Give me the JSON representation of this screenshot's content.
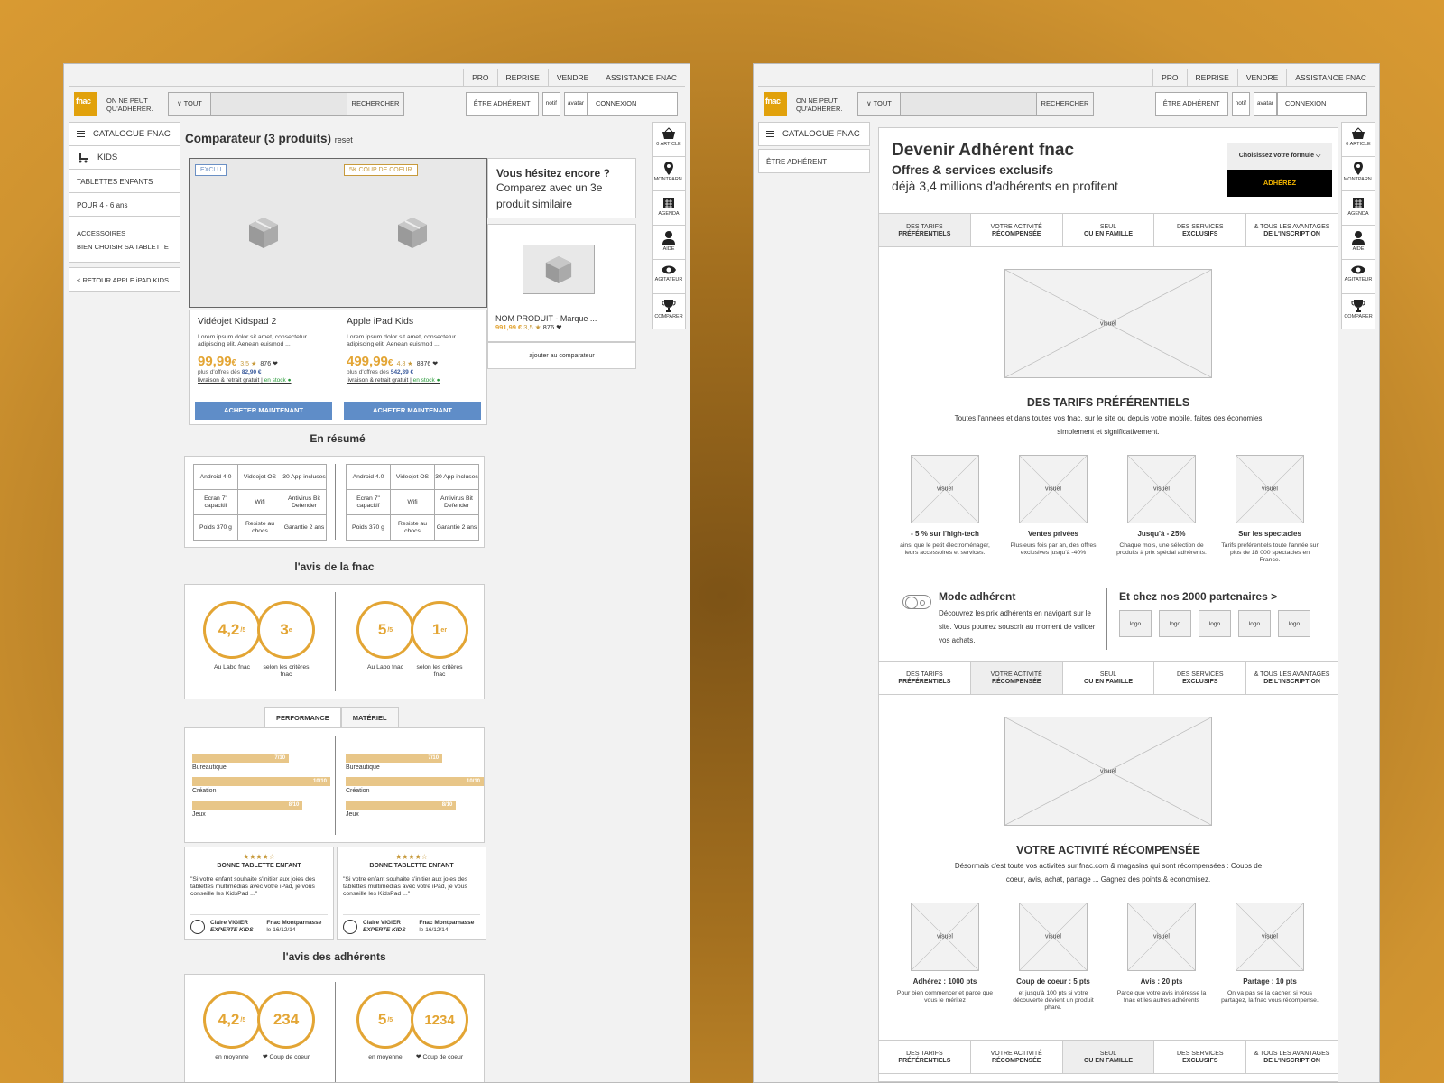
{
  "header": {
    "top_links": [
      "PRO",
      "REPRISE",
      "VENDRE",
      "ASSISTANCE FNAC"
    ],
    "logo": "fnac",
    "slogan": "ON NE PEUT QU'ADHERER.",
    "search_select": "∨ TOUT",
    "search_placeholder": "",
    "search_button": "RECHERCHER",
    "member_button": "ÊTRE ADHÉRENT",
    "notif": "notif",
    "avatar": "avatar",
    "login": "CONNEXION"
  },
  "right_nav": [
    "0 ARTICLE",
    "MONTPARN.",
    "AGENDA",
    "AIDE",
    "AGITATEUR",
    "COMPARER"
  ],
  "left_nav": {
    "catalog": "CATALOGUE FNAC",
    "kids": "KIDS",
    "tablettes": "TABLETTES ENFANTS",
    "age": "POUR 4 - 6 ans",
    "accessoires": "ACCESSOIRES",
    "bien_choisir": "BIEN CHOISIR SA TABLETTE",
    "retour": "< RETOUR APPLE iPAD KIDS"
  },
  "comparator": {
    "title": "Comparateur (3 produits)",
    "reset": "reset",
    "products": [
      {
        "tag": "EXCLU",
        "name": "Vidéojet Kidspad 2",
        "desc": "Lorem ipsum dolor sit amet, consectetur adipiscing elit. Aenean euismod ...",
        "price": "99,99",
        "currency": "€",
        "rating": "3,5 ★",
        "count": "876 ❤",
        "offers_label": "plus d'offres dès",
        "offers_price": "82,90 €",
        "delivery": "livraison & retrait gratuit",
        "stock": "en stock ●",
        "buy": "ACHETER MAINTENANT"
      },
      {
        "tag": "5K COUP DE COEUR",
        "name": "Apple iPad Kids",
        "desc": "Lorem ipsum dolor sit amet, consectetur adipiscing elit. Aenean euismod ...",
        "price": "499,99",
        "currency": "€",
        "rating": "4,8 ★",
        "count": "8376 ❤",
        "offers_label": "plus d'offres dès",
        "offers_price": "542,39 €",
        "delivery": "livraison & retrait gratuit",
        "stock": "en stock ●",
        "buy": "ACHETER MAINTENANT"
      }
    ],
    "hesitez_title": "Vous hésitez encore ?",
    "hesitez_text": "Comparez avec un 3e produit similaire",
    "similar_name": "NOM PRODUIT - Marque ...",
    "similar_price": "991,99 €",
    "similar_rating": "3,5 ★",
    "similar_count": "876 ❤",
    "add_compare": "ajouter au comparateur"
  },
  "resume": {
    "title": "En résumé",
    "specs": [
      "Android 4.0",
      "Videojet OS",
      "30 App incluses",
      "Ecran 7\" capacitif",
      "Wifi",
      "Antivirus Bit Defender",
      "Poids 370 g",
      "Resiste au chocs",
      "Garantie 2 ans"
    ]
  },
  "avis_fnac": {
    "title": "l'avis de la fnac",
    "products": [
      {
        "score": "4,2",
        "scale": "/5",
        "rank": "3",
        "rank_sup": "e",
        "label1": "Au Labo fnac",
        "label2": "selon les critères fnac"
      },
      {
        "score": "5",
        "scale": "/5",
        "rank": "1",
        "rank_sup": "er",
        "label1": "Au Labo fnac",
        "label2": "selon les critères fnac"
      }
    ]
  },
  "perf_tabs": [
    "PERFORMANCE",
    "MATÉRIEL"
  ],
  "perf_bars": [
    {
      "name": "Bureautique",
      "label": "7/10",
      "value": 7
    },
    {
      "name": "Création",
      "label": "10/10",
      "value": 10
    },
    {
      "name": "Jeux",
      "label": "8/10",
      "value": 8
    }
  ],
  "reviews": [
    {
      "stars": "★★★★☆",
      "title": "BONNE TABLETTE ENFANT",
      "text": "\"Si votre enfant souhaite s'initier aux joies des tablettes multimédias avec votre iPad, je vous conseille les KidsPad ...\"",
      "author": "Claire VIGIER",
      "role": "EXPERTE KIDS",
      "shop": "Fnac Montparnasse",
      "date": "le 16/12/14"
    },
    {
      "stars": "★★★★☆",
      "title": "BONNE TABLETTE ENFANT",
      "text": "\"Si votre enfant souhaite s'initier aux joies des tablettes multimédias avec votre iPad, je vous conseille les KidsPad ...\"",
      "author": "Claire VIGIER",
      "role": "EXPERTE KIDS",
      "shop": "Fnac Montparnasse",
      "date": "le 16/12/14"
    }
  ],
  "avis_adherents": {
    "title": "l'avis des adhérents",
    "products": [
      {
        "score": "4,2",
        "scale": "/5",
        "count": "234",
        "label1": "en moyenne",
        "label2": "❤ Coup de coeur"
      },
      {
        "score": "5",
        "scale": "/5",
        "count": "1234",
        "label1": "en moyenne",
        "label2": "❤ Coup de coeur"
      }
    ]
  },
  "adherent": {
    "left_item": "ÊTRE ADHÉRENT",
    "h1": "Devenir Adhérent fnac",
    "h2": "Offres & services exclusifs",
    "h3": "déjà 3,4 millions d'adhérents en profitent",
    "formule": "Choisissez votre formule ⌵",
    "adhere": "ADHÉREZ",
    "tabs": [
      [
        "DES TARIFS",
        "PRÉFÉRENTIELS"
      ],
      [
        "VOTRE ACTIVITÉ",
        "RÉCOMPENSÉE"
      ],
      [
        "SEUL",
        "OU EN FAMILLE"
      ],
      [
        "DES SERVICES",
        "EXCLUSIFS"
      ],
      [
        "& TOUS LES AVANTAGES",
        "DE L'INSCRIPTION"
      ]
    ],
    "visual": "visuel",
    "s1_title": "DES TARIFS PRÉFÉRENTIELS",
    "s1_text": "Toutes l'années et dans toutes vos fnac, sur le site ou depuis votre mobile, faites des économies simplement et significativement.",
    "s1_feats": [
      {
        "t": "- 5 % sur l'high-tech",
        "d": "ainsi que le petit électroménager, leurs accessoires et services."
      },
      {
        "t": "Ventes privées",
        "d": "Plusieurs fois par an, des offres exclusives jusqu'à -40%"
      },
      {
        "t": "Jusqu'à - 25%",
        "d": "Chaque mois, une sélection de produits à prix spécial adhérents."
      },
      {
        "t": "Sur les spectacles",
        "d": "Tarifs préférentiels toute l'année sur plus de 18 000 spectacles en France."
      }
    ],
    "mode_title": "Mode adhérent",
    "mode_text": "Découvrez les prix adhérents en navigant sur le site. Vous pourrez souscrir au moment de valider vos achats.",
    "partners_title": "Et chez nos 2000 partenaires >",
    "logo_label": "logo",
    "s2_title": "VOTRE ACTIVITÉ RÉCOMPENSÉE",
    "s2_text": "Désormais c'est toute vos activités sur fnac.com & magasins qui sont récompensées : Coups de coeur, avis, achat, partage ... Gagnez des points & economisez.",
    "s2_feats": [
      {
        "t": "Adhérez : 1000 pts",
        "d": "Pour bien commencer et parce que vous le méritez"
      },
      {
        "t": "Coup de coeur : 5 pts",
        "d": "et jusqu'à 100 pts si votre découverte devient un produit phare."
      },
      {
        "t": "Avis : 20 pts",
        "d": "Parce que votre avis intéresse la fnac et les autres adhérents"
      },
      {
        "t": "Partage : 10 pts",
        "d": "On va pas se la cacher, si vous partagez, la fnac vous récompense."
      }
    ]
  },
  "colors": {
    "accent": "#e3a534",
    "button": "#5f8dc8",
    "black": "#000000"
  }
}
